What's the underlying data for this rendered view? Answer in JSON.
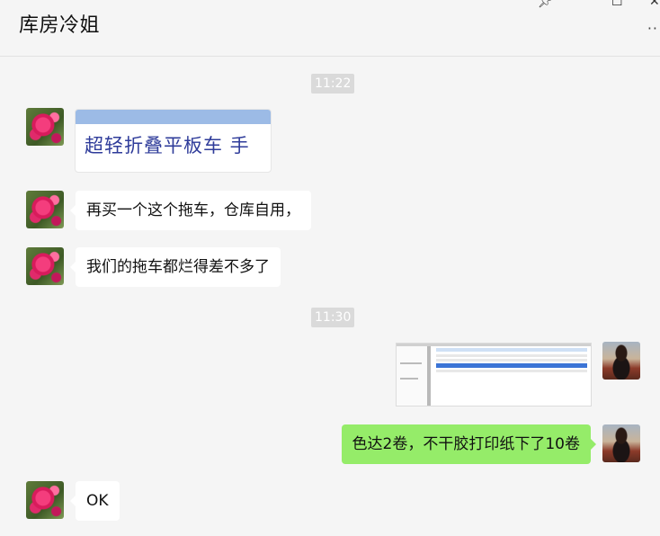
{
  "window": {
    "title": "库房冷姐",
    "pin_icon": "pin-icon",
    "more_label": "··"
  },
  "messages": [
    {
      "type": "time",
      "text": "11:22"
    },
    {
      "type": "link-card",
      "sender": "other",
      "text": "超轻折叠平板车 手"
    },
    {
      "type": "text",
      "sender": "other",
      "text": "再买一个这个拖车，仓库自用，"
    },
    {
      "type": "text",
      "sender": "other",
      "text": "我们的拖车都烂得差不多了"
    },
    {
      "type": "time",
      "text": "11:30"
    },
    {
      "type": "image",
      "sender": "me"
    },
    {
      "type": "text",
      "sender": "me",
      "text": "色达2卷，不干胶打印纸下了10卷"
    },
    {
      "type": "text",
      "sender": "other",
      "text": "OK"
    }
  ],
  "colors": {
    "background": "#f5f5f5",
    "my_bubble": "#95ec69",
    "other_bubble": "#ffffff",
    "timestamp_bg": "#dadada"
  }
}
